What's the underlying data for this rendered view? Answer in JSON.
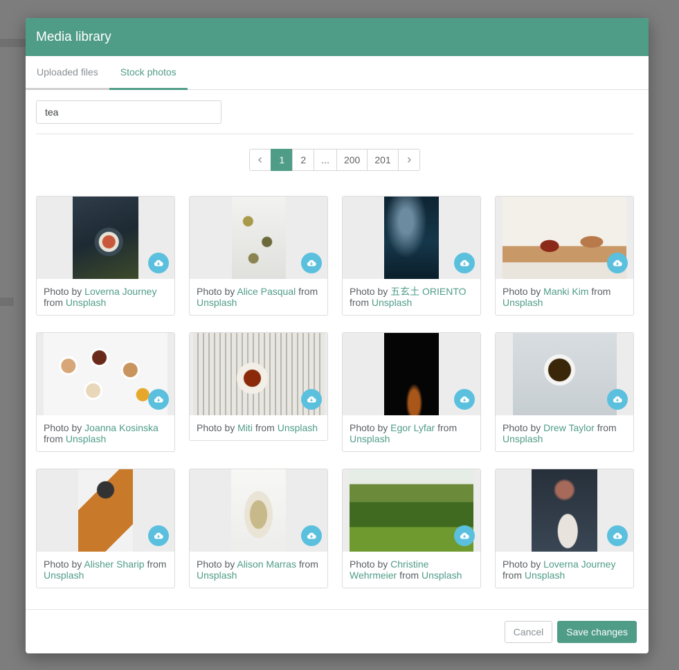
{
  "modal": {
    "title": "Media library"
  },
  "tabs": [
    {
      "label": "Uploaded files",
      "active": false
    },
    {
      "label": "Stock photos",
      "active": true
    }
  ],
  "search": {
    "value": "tea",
    "placeholder": ""
  },
  "pagination": {
    "pages": [
      "1",
      "2",
      "...",
      "200",
      "201"
    ],
    "current": "1"
  },
  "caption_words": {
    "photo_by": "Photo by",
    "from": "from"
  },
  "photos": [
    {
      "author": "Loverna Journey",
      "source": "Unsplash"
    },
    {
      "author": "Alice Pasqual",
      "source": "Unsplash"
    },
    {
      "author": "五玄土 ORIENTO",
      "source": "Unsplash"
    },
    {
      "author": "Manki Kim",
      "source": "Unsplash"
    },
    {
      "author": "Joanna Kosinska",
      "source": "Unsplash"
    },
    {
      "author": "Miti",
      "source": "Unsplash"
    },
    {
      "author": "Egor Lyfar",
      "source": "Unsplash"
    },
    {
      "author": "Drew Taylor",
      "source": "Unsplash"
    },
    {
      "author": "Alisher Sharip",
      "source": "Unsplash"
    },
    {
      "author": "Alison Marras",
      "source": "Unsplash"
    },
    {
      "author": "Christine Wehrmeier",
      "source": "Unsplash"
    },
    {
      "author": "Loverna Journey",
      "source": "Unsplash"
    }
  ],
  "footer": {
    "cancel_label": "Cancel",
    "save_label": "Save changes"
  },
  "colors": {
    "accent": "#4f9c87",
    "download_button": "#5bc0de"
  }
}
